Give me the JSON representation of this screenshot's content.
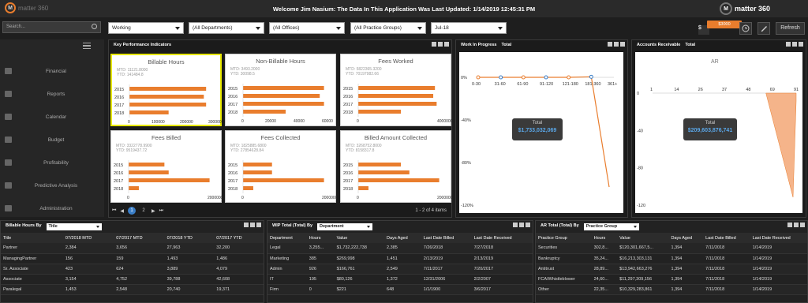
{
  "app": {
    "logo_text": "matter 360",
    "welcome": "Welcome Jim Nasium: The Data In This Application Was Last Updated: 1/14/2019 12:45:31 PM",
    "brand": "matter 360"
  },
  "filters": {
    "search_placeholder": "Search...",
    "status": "Working",
    "department": "(All Departments)",
    "office": "(All Offices)",
    "practice_group": "(All Practice Groups)",
    "period": "Jul-18"
  },
  "toolbar": {
    "dollar": "$",
    "badge": "$3000",
    "refresh": "Refresh"
  },
  "sidebar": {
    "items": [
      {
        "label": "Financial",
        "icon": "dollar-bill-icon"
      },
      {
        "label": "Reports",
        "icon": "document-icon"
      },
      {
        "label": "Calendar",
        "icon": "calendar-icon"
      },
      {
        "label": "Budget",
        "icon": "calendar-icon"
      },
      {
        "label": "Profitability",
        "icon": "arrows-icon"
      },
      {
        "label": "Predictive Analysis",
        "icon": "bar-chart-icon"
      },
      {
        "label": "Administration",
        "icon": "gear-icon"
      }
    ]
  },
  "kpi_panel": {
    "title": "Key Performance Indicators",
    "pager": {
      "pages": [
        "1",
        "2"
      ],
      "info": "1 - 2 of 4 items"
    }
  },
  "kpis": [
    {
      "title": "Billable Hours",
      "mtd": "MTD: 11121.8000",
      "ytd": "YTD: 141484.8",
      "ticks": [
        "0",
        "100000",
        "200000",
        "300000"
      ],
      "years": [
        "2015",
        "2016",
        "2017",
        "2018"
      ],
      "values": [
        270000,
        262000,
        270000,
        138000
      ],
      "max": 300000
    },
    {
      "title": "Non-Billable Hours",
      "mtd": "MTD: 3493.2000",
      "ytd": "YTD: 30098.5",
      "ticks": [
        "0",
        "20000",
        "40000",
        "60000"
      ],
      "years": [
        "2015",
        "2016",
        "2017",
        "2018"
      ],
      "values": [
        57000,
        54000,
        57000,
        30000
      ],
      "max": 60000
    },
    {
      "title": "Fees Worked",
      "mtd": "MTD: 5822365.3200",
      "ytd": "YTD: 70197982.66",
      "ticks": [
        "0",
        "40000000000000000120000000000000000"
      ],
      "years": [
        "2015",
        "2016",
        "2017",
        "2018"
      ],
      "values": [
        0.9,
        0.88,
        0.92,
        0.5
      ],
      "max": 1
    },
    {
      "title": "Fees Billed",
      "mtd": "MTD: 3322778.9900",
      "ytd": "YTD: 9519437.72",
      "ticks": [
        "0",
        "20000000400000006000000080000000"
      ],
      "years": [
        "2015",
        "2016",
        "2017",
        "2018"
      ],
      "values": [
        0.42,
        0.47,
        0.95,
        0.12
      ],
      "max": 1
    },
    {
      "title": "Fees Collected",
      "mtd": "MTD: 1825885.6800",
      "ytd": "YTD: 27854628.84",
      "ticks": [
        "0",
        "2000000040000000600000008000000"
      ],
      "years": [
        "2015",
        "2016",
        "2017",
        "2018"
      ],
      "values": [
        0.34,
        0.34,
        0.95,
        0.12
      ],
      "max": 1
    },
    {
      "title": "Billed Amount Collected",
      "mtd": "MTD: 3268752.8000",
      "ytd": "YTD: 8158317.8",
      "ticks": [
        "0",
        "20000000400000006000000080000000"
      ],
      "years": [
        "2015",
        "2016",
        "2017",
        "2018"
      ],
      "values": [
        0.5,
        0.6,
        0.95,
        0.12
      ],
      "max": 1
    }
  ],
  "chart_data": [
    {
      "type": "line",
      "title": "Work In Progress",
      "selector": "Total",
      "categories": [
        "0-30",
        "31-60",
        "61-90",
        "91-120",
        "121-180",
        "181-360",
        "361+"
      ],
      "values": [
        0,
        0,
        0,
        0,
        0,
        0.5,
        -103
      ],
      "ylim": [
        -120,
        0
      ],
      "yticks": [
        "0%",
        "-40%",
        "-80%",
        "-120%"
      ],
      "total_label": "Total",
      "total_value": "$1,733,032,069"
    },
    {
      "type": "area",
      "title": "Accounts Receivable",
      "selector": "Total",
      "subtitle": "AR",
      "xticks": [
        "1",
        "14",
        "26",
        "37",
        "48",
        "69",
        "91"
      ],
      "yticks": [
        "0",
        "-40",
        "-80",
        "-120"
      ],
      "ylim": [
        -120,
        0
      ],
      "total_label": "Total",
      "total_value": "$209,603,876,741"
    }
  ],
  "tables": [
    {
      "title": "Billable Hours By",
      "selector": "Title",
      "columns": [
        "Title",
        "07/2018 MTD",
        "07/2017 MTD",
        "07/2018 YTD",
        "07/2017 YTD"
      ],
      "rows": [
        [
          "Partner",
          "2,384",
          "3,656",
          "27,963",
          "32,200"
        ],
        [
          "ManagingPartner",
          "156",
          "159",
          "1,493",
          "1,486"
        ],
        [
          "Sr. Associate",
          "423",
          "624",
          "3,889",
          "4,079"
        ],
        [
          "Associate",
          "3,154",
          "4,752",
          "39,788",
          "42,608"
        ],
        [
          "Paralegal",
          "1,453",
          "2,548",
          "20,740",
          "19,371"
        ],
        [
          "",
          "",
          "",
          "",
          ""
        ]
      ]
    },
    {
      "title": "WIP Total (Total) By",
      "selector": "Department",
      "columns": [
        "Department",
        "Hours",
        "Value",
        "Days Aged",
        "Last Date Billed",
        "Last Date Received"
      ],
      "rows": [
        [
          "Legal",
          "3,255...",
          "$1,732,222,738",
          "2,385",
          "7/26/2018",
          "7/27/2018"
        ],
        [
          "Marketing",
          "385",
          "$269,998",
          "1,451",
          "2/13/2019",
          "2/13/2019"
        ],
        [
          "Admin",
          "926",
          "$166,761",
          "2,549",
          "7/11/2017",
          "7/20/2017"
        ],
        [
          "IT",
          "195",
          "$80,126",
          "1,372",
          "12/31/2006",
          "2/2/2007"
        ],
        [
          "Firm",
          "0",
          "$221",
          "648",
          "1/1/1900",
          "3/6/2017"
        ],
        [
          "",
          "",
          "",
          "",
          "",
          ""
        ]
      ]
    },
    {
      "title": "AR Total (Total) By",
      "selector": "Practice Group",
      "columns": [
        "Practice Group",
        "Hours",
        "Value",
        "Days Aged",
        "Last Date Billed",
        "Last Date Received"
      ],
      "rows": [
        [
          "Securities",
          "302,8...",
          "$120,301,667,5...",
          "1,394",
          "7/11/2018",
          "1/14/2019"
        ],
        [
          "Bankruptcy",
          "35,24...",
          "$16,213,303,131",
          "1,394",
          "7/11/2018",
          "1/14/2019"
        ],
        [
          "Antitrust",
          "28,89...",
          "$13,942,663,276",
          "1,394",
          "7/11/2018",
          "1/14/2019"
        ],
        [
          "FCA/Whistleblower",
          "24,60...",
          "$11,297,309,156",
          "1,394",
          "7/11/2018",
          "1/14/2019"
        ],
        [
          "Other",
          "22,35...",
          "$10,329,283,861",
          "1,394",
          "7/11/2018",
          "1/14/2019"
        ],
        [
          "",
          "",
          "",
          "",
          "",
          ""
        ]
      ]
    }
  ],
  "colors": {
    "accent": "#e97d2d",
    "highlight": "#e8e800",
    "link": "#5aa7e8"
  }
}
